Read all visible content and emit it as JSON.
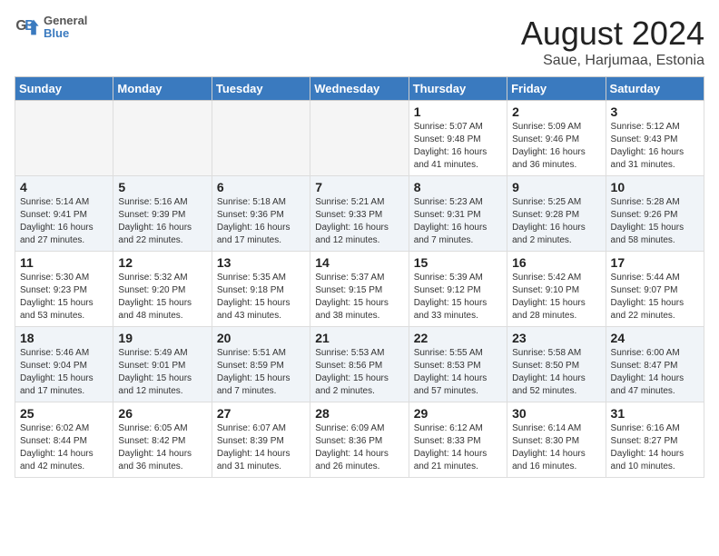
{
  "header": {
    "logo_line1": "General",
    "logo_line2": "Blue",
    "title": "August 2024",
    "subtitle": "Saue, Harjumaa, Estonia"
  },
  "weekdays": [
    "Sunday",
    "Monday",
    "Tuesday",
    "Wednesday",
    "Thursday",
    "Friday",
    "Saturday"
  ],
  "weeks": [
    [
      {
        "day": "",
        "info": ""
      },
      {
        "day": "",
        "info": ""
      },
      {
        "day": "",
        "info": ""
      },
      {
        "day": "",
        "info": ""
      },
      {
        "day": "1",
        "info": "Sunrise: 5:07 AM\nSunset: 9:48 PM\nDaylight: 16 hours\nand 41 minutes."
      },
      {
        "day": "2",
        "info": "Sunrise: 5:09 AM\nSunset: 9:46 PM\nDaylight: 16 hours\nand 36 minutes."
      },
      {
        "day": "3",
        "info": "Sunrise: 5:12 AM\nSunset: 9:43 PM\nDaylight: 16 hours\nand 31 minutes."
      }
    ],
    [
      {
        "day": "4",
        "info": "Sunrise: 5:14 AM\nSunset: 9:41 PM\nDaylight: 16 hours\nand 27 minutes."
      },
      {
        "day": "5",
        "info": "Sunrise: 5:16 AM\nSunset: 9:39 PM\nDaylight: 16 hours\nand 22 minutes."
      },
      {
        "day": "6",
        "info": "Sunrise: 5:18 AM\nSunset: 9:36 PM\nDaylight: 16 hours\nand 17 minutes."
      },
      {
        "day": "7",
        "info": "Sunrise: 5:21 AM\nSunset: 9:33 PM\nDaylight: 16 hours\nand 12 minutes."
      },
      {
        "day": "8",
        "info": "Sunrise: 5:23 AM\nSunset: 9:31 PM\nDaylight: 16 hours\nand 7 minutes."
      },
      {
        "day": "9",
        "info": "Sunrise: 5:25 AM\nSunset: 9:28 PM\nDaylight: 16 hours\nand 2 minutes."
      },
      {
        "day": "10",
        "info": "Sunrise: 5:28 AM\nSunset: 9:26 PM\nDaylight: 15 hours\nand 58 minutes."
      }
    ],
    [
      {
        "day": "11",
        "info": "Sunrise: 5:30 AM\nSunset: 9:23 PM\nDaylight: 15 hours\nand 53 minutes."
      },
      {
        "day": "12",
        "info": "Sunrise: 5:32 AM\nSunset: 9:20 PM\nDaylight: 15 hours\nand 48 minutes."
      },
      {
        "day": "13",
        "info": "Sunrise: 5:35 AM\nSunset: 9:18 PM\nDaylight: 15 hours\nand 43 minutes."
      },
      {
        "day": "14",
        "info": "Sunrise: 5:37 AM\nSunset: 9:15 PM\nDaylight: 15 hours\nand 38 minutes."
      },
      {
        "day": "15",
        "info": "Sunrise: 5:39 AM\nSunset: 9:12 PM\nDaylight: 15 hours\nand 33 minutes."
      },
      {
        "day": "16",
        "info": "Sunrise: 5:42 AM\nSunset: 9:10 PM\nDaylight: 15 hours\nand 28 minutes."
      },
      {
        "day": "17",
        "info": "Sunrise: 5:44 AM\nSunset: 9:07 PM\nDaylight: 15 hours\nand 22 minutes."
      }
    ],
    [
      {
        "day": "18",
        "info": "Sunrise: 5:46 AM\nSunset: 9:04 PM\nDaylight: 15 hours\nand 17 minutes."
      },
      {
        "day": "19",
        "info": "Sunrise: 5:49 AM\nSunset: 9:01 PM\nDaylight: 15 hours\nand 12 minutes."
      },
      {
        "day": "20",
        "info": "Sunrise: 5:51 AM\nSunset: 8:59 PM\nDaylight: 15 hours\nand 7 minutes."
      },
      {
        "day": "21",
        "info": "Sunrise: 5:53 AM\nSunset: 8:56 PM\nDaylight: 15 hours\nand 2 minutes."
      },
      {
        "day": "22",
        "info": "Sunrise: 5:55 AM\nSunset: 8:53 PM\nDaylight: 14 hours\nand 57 minutes."
      },
      {
        "day": "23",
        "info": "Sunrise: 5:58 AM\nSunset: 8:50 PM\nDaylight: 14 hours\nand 52 minutes."
      },
      {
        "day": "24",
        "info": "Sunrise: 6:00 AM\nSunset: 8:47 PM\nDaylight: 14 hours\nand 47 minutes."
      }
    ],
    [
      {
        "day": "25",
        "info": "Sunrise: 6:02 AM\nSunset: 8:44 PM\nDaylight: 14 hours\nand 42 minutes."
      },
      {
        "day": "26",
        "info": "Sunrise: 6:05 AM\nSunset: 8:42 PM\nDaylight: 14 hours\nand 36 minutes."
      },
      {
        "day": "27",
        "info": "Sunrise: 6:07 AM\nSunset: 8:39 PM\nDaylight: 14 hours\nand 31 minutes."
      },
      {
        "day": "28",
        "info": "Sunrise: 6:09 AM\nSunset: 8:36 PM\nDaylight: 14 hours\nand 26 minutes."
      },
      {
        "day": "29",
        "info": "Sunrise: 6:12 AM\nSunset: 8:33 PM\nDaylight: 14 hours\nand 21 minutes."
      },
      {
        "day": "30",
        "info": "Sunrise: 6:14 AM\nSunset: 8:30 PM\nDaylight: 14 hours\nand 16 minutes."
      },
      {
        "day": "31",
        "info": "Sunrise: 6:16 AM\nSunset: 8:27 PM\nDaylight: 14 hours\nand 10 minutes."
      }
    ]
  ]
}
